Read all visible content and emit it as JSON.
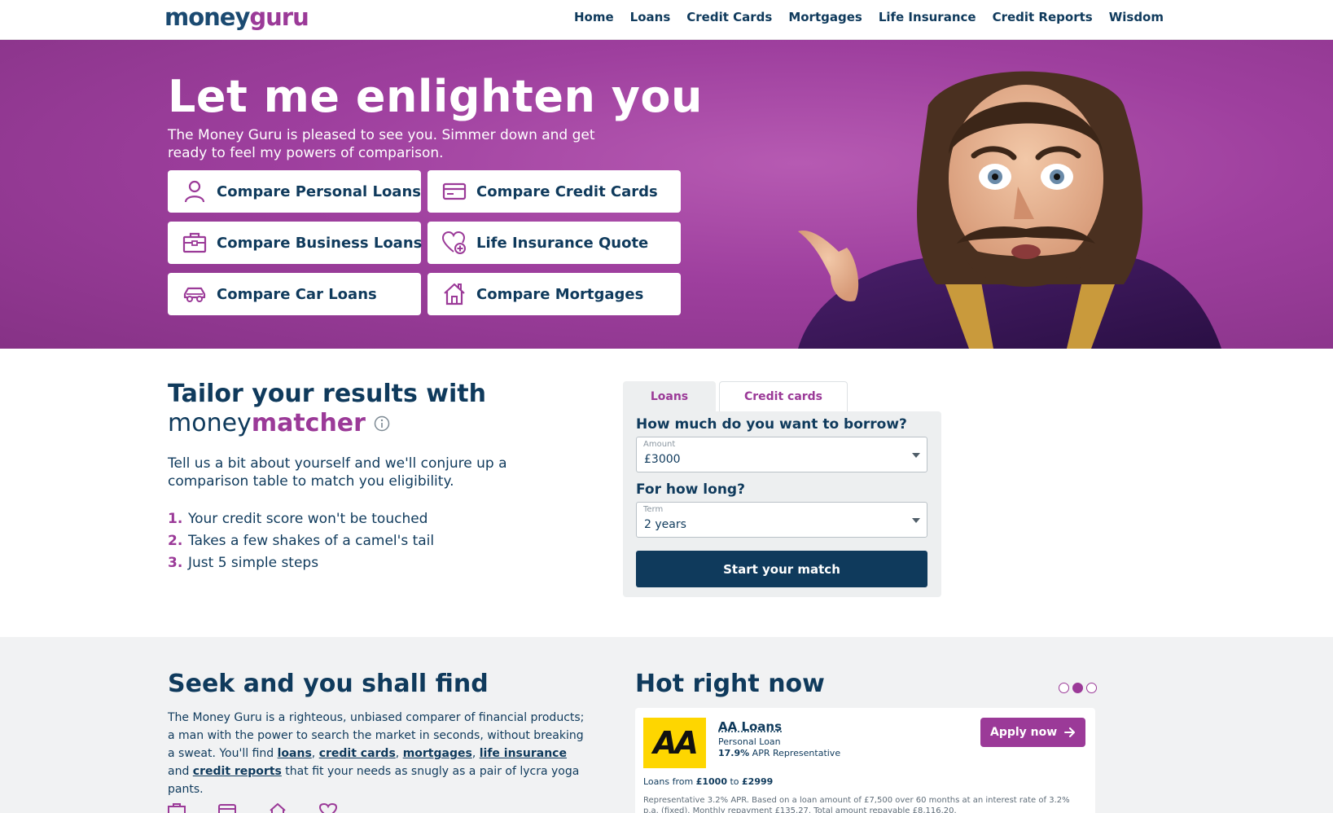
{
  "header": {
    "logo": {
      "part1": "money",
      "part2": "guru"
    },
    "nav": [
      "Home",
      "Loans",
      "Credit Cards",
      "Mortgages",
      "Life Insurance",
      "Credit Reports",
      "Wisdom"
    ]
  },
  "hero": {
    "title": "Let me enlighten you",
    "subtitle": "The Money Guru is pleased to see you. Simmer down and get ready to feel my powers of comparison.",
    "buttons": [
      {
        "label": "Compare Personal Loans",
        "icon": "person-icon"
      },
      {
        "label": "Compare Credit Cards",
        "icon": "credit-card-icon"
      },
      {
        "label": "Compare Business Loans",
        "icon": "briefcase-icon"
      },
      {
        "label": "Life Insurance Quote",
        "icon": "heart-plus-icon"
      },
      {
        "label": "Compare Car Loans",
        "icon": "car-icon"
      },
      {
        "label": "Compare Mortgages",
        "icon": "house-icon"
      }
    ]
  },
  "matcher": {
    "heading": "Tailor your results with",
    "brand1": "money",
    "brand2": "matcher",
    "description": "Tell us a bit about yourself and we'll conjure up a comparison table to match you eligibility.",
    "steps": [
      {
        "num": "1.",
        "text": "Your credit score won't be touched"
      },
      {
        "num": "2.",
        "text": "Takes a few shakes of a camel's tail"
      },
      {
        "num": "3.",
        "text": "Just 5 simple steps"
      }
    ],
    "tabs": [
      "Loans",
      "Credit cards"
    ],
    "active_tab": "Loans",
    "borrow_question": "How much do you want to borrow?",
    "amount_caption": "Amount",
    "amount_value": "£3000",
    "term_question": "For how long?",
    "term_caption": "Term",
    "term_value": "2 years",
    "submit_label": "Start your match"
  },
  "seek": {
    "heading": "Seek and you shall find",
    "text_before": "The Money Guru is a righteous, unbiased comparer of financial products; a man with the power to search the market in seconds, without breaking a sweat. You'll find",
    "links": [
      "loans",
      "credit cards",
      "mortgages",
      "life insurance",
      "credit reports"
    ],
    "sep1": ", ",
    "sep_and": " and ",
    "text_after": " that fit your needs as snugly as a pair of lycra yoga pants."
  },
  "hot": {
    "heading": "Hot right now",
    "slides_total": 3,
    "slide_active": 2,
    "card": {
      "logo_text": "AA",
      "name": "AA Loans",
      "type": "Personal Loan",
      "apr_value": "17.9%",
      "apr_label": " APR Representative",
      "apply_label": "Apply now",
      "range_prefix": "Loans from ",
      "range_min": "£1000",
      "range_to": " to ",
      "range_max": "£2999",
      "representative": "Representative 3.2% APR. Based on a loan amount of £7,500 over 60 months at an interest rate of 3.2% p.a. (fixed). Monthly repayment £135.27. Total amount repayable £8,116.20."
    }
  },
  "colors": {
    "navy": "#0f3a5c",
    "purple": "#9b3a98",
    "hero_bg": "#9e3f9e",
    "aa_yellow": "#fed600",
    "panel_bg": "#edeff0"
  }
}
